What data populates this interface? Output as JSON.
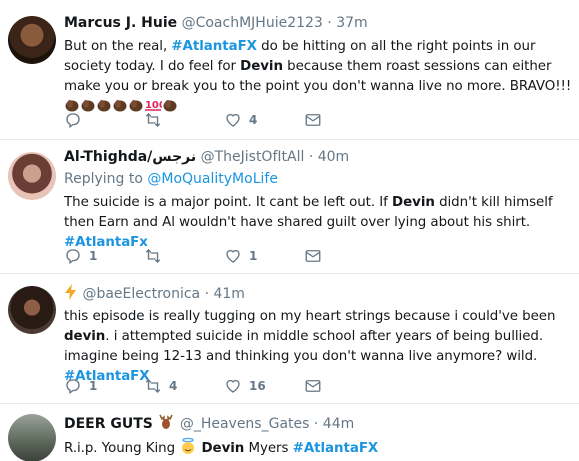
{
  "tweets": [
    {
      "name": "Marcus J. Huie",
      "handle": "@CoachMJHuie2123",
      "time": "37m",
      "text_parts": {
        "p1": "But on the real, ",
        "tag1": "#AtlantaFX",
        "p2": " do be hitting on all the right points in our society today. I do feel for ",
        "b1": "Devin",
        "p3": " because them roast sessions can either make you or break you to the point you don't wanna live no more. BRAVO!!!"
      },
      "emoji": [
        "clapping-hands",
        "clapping-hands",
        "clapping-hands",
        "clapping-hands",
        "clapping-hands",
        "hundred-points",
        "clapping-hands"
      ],
      "replies": "",
      "retweets": "",
      "likes": "4"
    },
    {
      "name": "Al-Thighda/نرجس",
      "handle": "@TheJistOfItAll",
      "time": "40m",
      "replying_label": "Replying to ",
      "replying_to": "@MoQualityMoLife",
      "text_parts": {
        "p1": "The suicide is a major point. It cant be left out. If ",
        "b1": "Devin",
        "p2": " didn't kill himself then Earn and Al wouldn't have shared guilt over lying about his shirt. ",
        "tag1": "#AtlantaFx"
      },
      "replies": "1",
      "retweets": "",
      "likes": "1"
    },
    {
      "name_icon": "lightning-icon",
      "handle": "@baeElectronica",
      "time": "41m",
      "text_parts": {
        "p1": "this episode is really tugging on my heart strings because i could've been ",
        "b1": "devin",
        "p2": ". i attempted suicide in middle school after years of being bullied. imagine being 12-13 and thinking you don't wanna live anymore? wild.  ",
        "tag1": "#AtlantaFX"
      },
      "replies": "1",
      "retweets": "4",
      "likes": "16"
    },
    {
      "name": "DEER GUTS",
      "name_icon": "deer-emoji",
      "handle": "@_Heavens_Gates",
      "time": "44m",
      "text_parts": {
        "p1": "R.i.p. Young King ",
        "b1": "Devin",
        "p2": " Myers ",
        "tag1": "#AtlantaFX"
      },
      "inline_emoji": "angel-face"
    }
  ],
  "separator": "·",
  "colors": {
    "link": "#1b95e0",
    "muted": "#657786",
    "text": "#14171a",
    "divider": "#e6ecf0"
  }
}
